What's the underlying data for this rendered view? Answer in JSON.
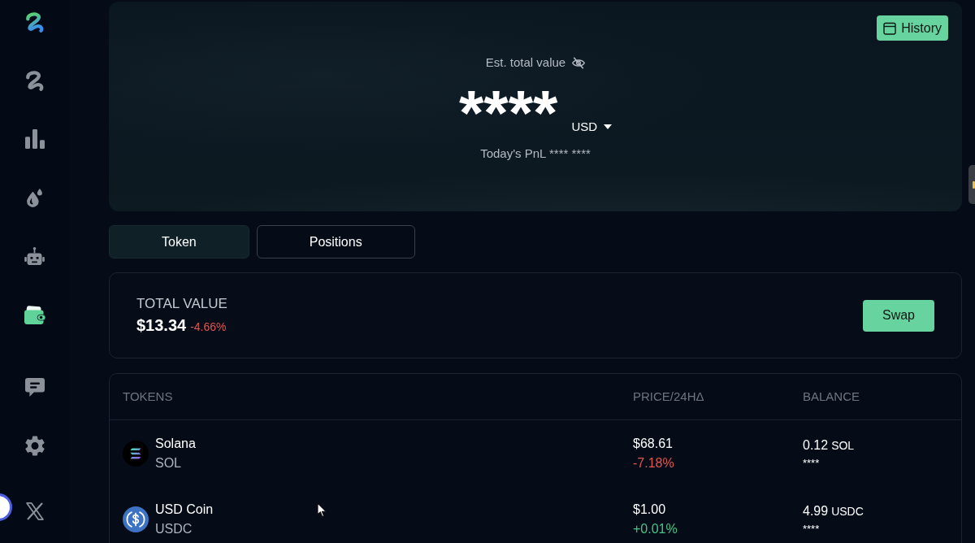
{
  "sidebar": {
    "items": [
      {
        "kind": "swirl",
        "selected": false
      },
      {
        "kind": "chart",
        "selected": false
      },
      {
        "kind": "drops",
        "selected": false
      },
      {
        "kind": "robot",
        "selected": false
      },
      {
        "kind": "wallet",
        "selected": true
      }
    ],
    "bottom_items": [
      {
        "kind": "chat",
        "selected": false
      },
      {
        "kind": "gear",
        "selected": false
      },
      {
        "kind": "x",
        "selected": false
      }
    ]
  },
  "hero": {
    "history_button": "History",
    "label": "Est. total value",
    "hidden": true,
    "value": "****",
    "currency": "USD",
    "pnl": "Today's PnL **** ****"
  },
  "tabs": [
    {
      "label": "Token",
      "selected": true
    },
    {
      "label": "Positions",
      "selected": false
    }
  ],
  "summary": {
    "label": "TOTAL VALUE",
    "value": "$13.34",
    "change": "-4.66%",
    "negative": true,
    "swap_button": "Swap"
  },
  "table": {
    "columns": [
      "TOKENS",
      "PRICE/24HΔ",
      "BALANCE"
    ],
    "rows": [
      {
        "kind": "stripes",
        "name": "Solana",
        "symbol": "SOL",
        "price": "$68.61",
        "change": "-7.18%",
        "negative": true,
        "balance": "0.12",
        "balance_unit": "SOL",
        "balance_value": "****"
      },
      {
        "kind": "dollar",
        "name": "USD Coin",
        "symbol": "USDC",
        "price": "$1.00",
        "change": "+0.01%",
        "negative": false,
        "balance": "4.99",
        "balance_unit": "USDC",
        "balance_value": "****"
      }
    ]
  }
}
